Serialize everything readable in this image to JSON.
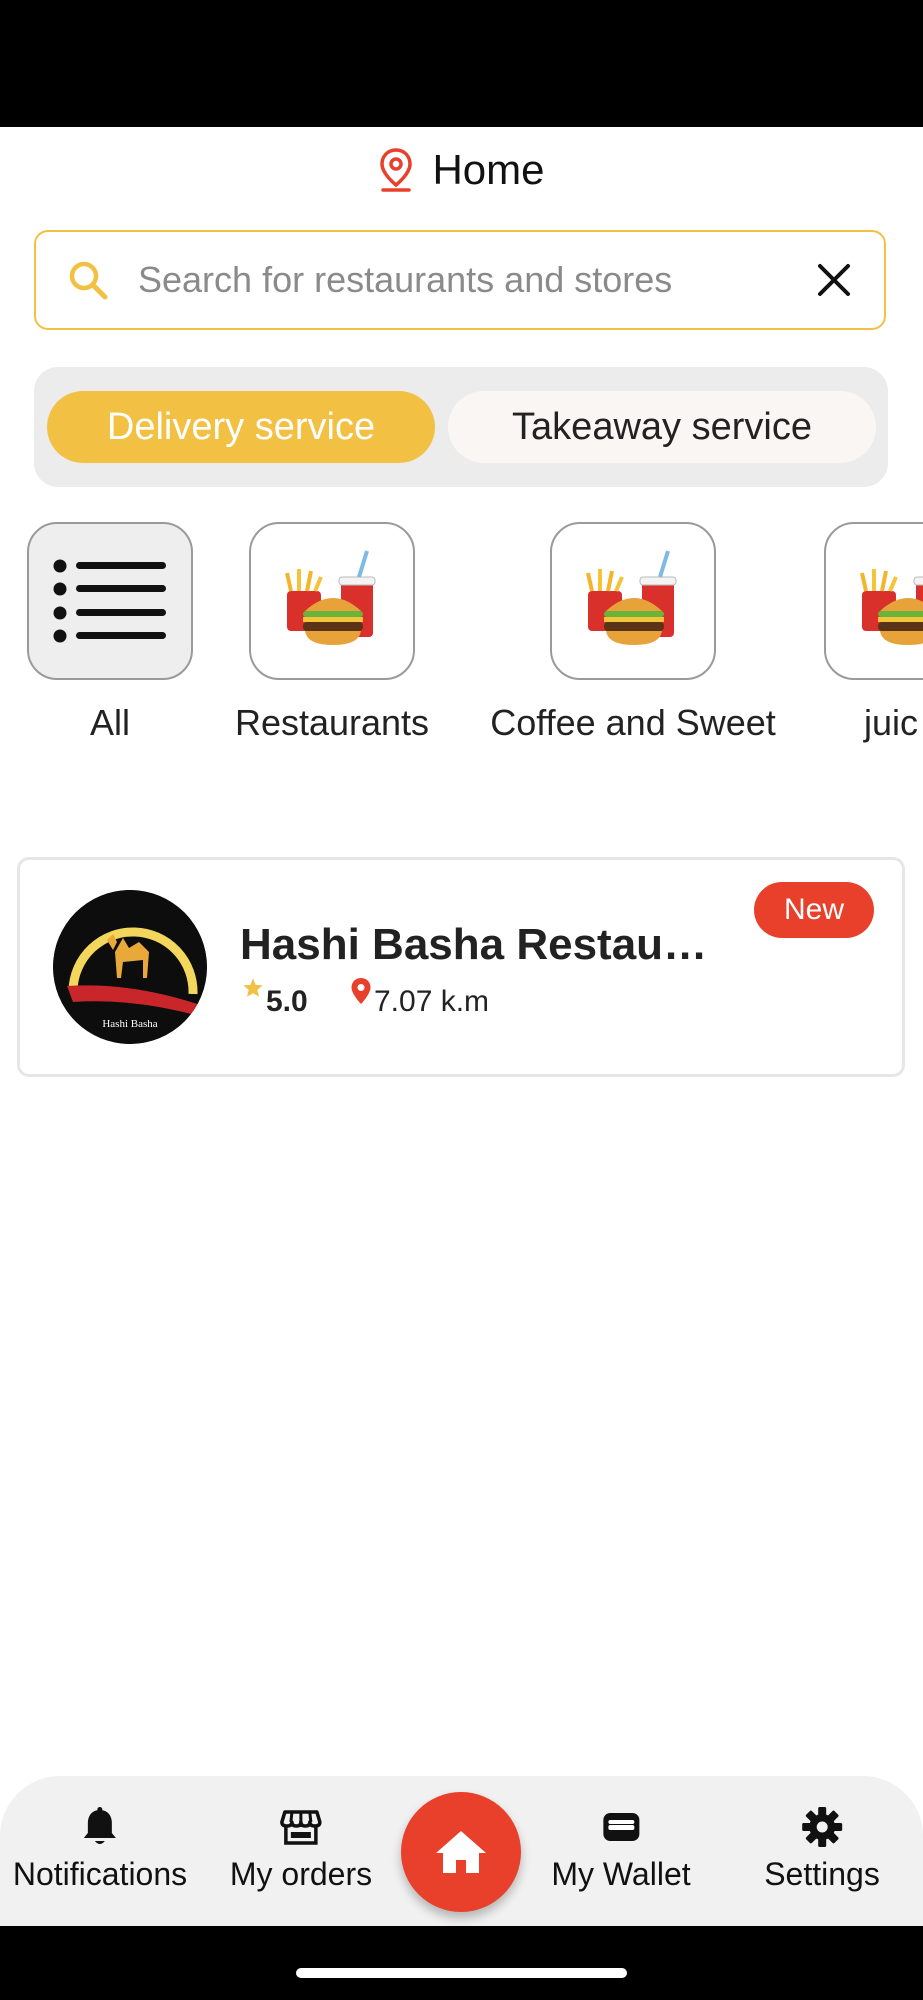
{
  "header": {
    "title": "Home",
    "location_icon": "location-pin-icon"
  },
  "search": {
    "placeholder": "Search for restaurants and stores",
    "value": ""
  },
  "service_toggle": {
    "options": [
      {
        "label": "Delivery service",
        "selected": true
      },
      {
        "label": "Takeaway service",
        "selected": false
      }
    ]
  },
  "categories": [
    {
      "label": "All",
      "icon": "list-icon",
      "selected": true
    },
    {
      "label": "Restaurants",
      "icon": "burger-meal-icon"
    },
    {
      "label": "Coffee and Sweet",
      "icon": "burger-meal-icon"
    },
    {
      "label": "juic",
      "icon": "burger-meal-icon"
    }
  ],
  "restaurants": [
    {
      "name": "Hashi Basha Restaur...",
      "rating": "5.0",
      "distance": "7.07 k.m",
      "badge": "New",
      "logo_text": "Hashi Basha"
    }
  ],
  "bottom_nav": {
    "items": [
      {
        "label": "Notifications",
        "icon": "bell-icon"
      },
      {
        "label": "My orders",
        "icon": "store-icon"
      },
      {
        "label": "",
        "icon": "home-icon"
      },
      {
        "label": "My Wallet",
        "icon": "wallet-icon"
      },
      {
        "label": "Settings",
        "icon": "gear-icon"
      }
    ]
  },
  "colors": {
    "accent_yellow": "#f2c144",
    "accent_red": "#e8402b",
    "toggle_bg": "#ececec"
  }
}
